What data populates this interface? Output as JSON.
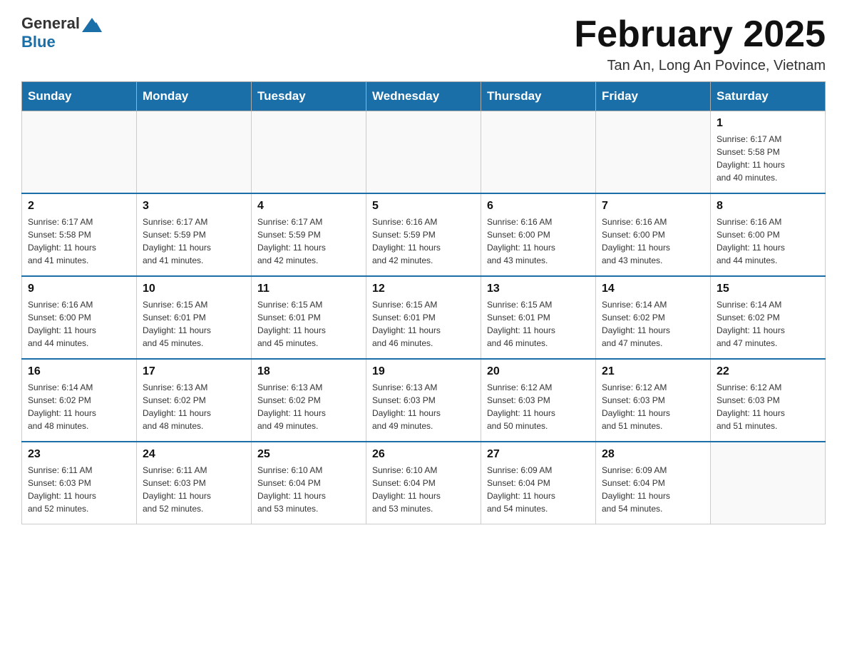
{
  "header": {
    "logo_general": "General",
    "logo_blue": "Blue",
    "month_title": "February 2025",
    "subtitle": "Tan An, Long An Povince, Vietnam"
  },
  "days_of_week": [
    "Sunday",
    "Monday",
    "Tuesday",
    "Wednesday",
    "Thursday",
    "Friday",
    "Saturday"
  ],
  "weeks": [
    [
      {
        "day": "",
        "info": ""
      },
      {
        "day": "",
        "info": ""
      },
      {
        "day": "",
        "info": ""
      },
      {
        "day": "",
        "info": ""
      },
      {
        "day": "",
        "info": ""
      },
      {
        "day": "",
        "info": ""
      },
      {
        "day": "1",
        "info": "Sunrise: 6:17 AM\nSunset: 5:58 PM\nDaylight: 11 hours\nand 40 minutes."
      }
    ],
    [
      {
        "day": "2",
        "info": "Sunrise: 6:17 AM\nSunset: 5:58 PM\nDaylight: 11 hours\nand 41 minutes."
      },
      {
        "day": "3",
        "info": "Sunrise: 6:17 AM\nSunset: 5:59 PM\nDaylight: 11 hours\nand 41 minutes."
      },
      {
        "day": "4",
        "info": "Sunrise: 6:17 AM\nSunset: 5:59 PM\nDaylight: 11 hours\nand 42 minutes."
      },
      {
        "day": "5",
        "info": "Sunrise: 6:16 AM\nSunset: 5:59 PM\nDaylight: 11 hours\nand 42 minutes."
      },
      {
        "day": "6",
        "info": "Sunrise: 6:16 AM\nSunset: 6:00 PM\nDaylight: 11 hours\nand 43 minutes."
      },
      {
        "day": "7",
        "info": "Sunrise: 6:16 AM\nSunset: 6:00 PM\nDaylight: 11 hours\nand 43 minutes."
      },
      {
        "day": "8",
        "info": "Sunrise: 6:16 AM\nSunset: 6:00 PM\nDaylight: 11 hours\nand 44 minutes."
      }
    ],
    [
      {
        "day": "9",
        "info": "Sunrise: 6:16 AM\nSunset: 6:00 PM\nDaylight: 11 hours\nand 44 minutes."
      },
      {
        "day": "10",
        "info": "Sunrise: 6:15 AM\nSunset: 6:01 PM\nDaylight: 11 hours\nand 45 minutes."
      },
      {
        "day": "11",
        "info": "Sunrise: 6:15 AM\nSunset: 6:01 PM\nDaylight: 11 hours\nand 45 minutes."
      },
      {
        "day": "12",
        "info": "Sunrise: 6:15 AM\nSunset: 6:01 PM\nDaylight: 11 hours\nand 46 minutes."
      },
      {
        "day": "13",
        "info": "Sunrise: 6:15 AM\nSunset: 6:01 PM\nDaylight: 11 hours\nand 46 minutes."
      },
      {
        "day": "14",
        "info": "Sunrise: 6:14 AM\nSunset: 6:02 PM\nDaylight: 11 hours\nand 47 minutes."
      },
      {
        "day": "15",
        "info": "Sunrise: 6:14 AM\nSunset: 6:02 PM\nDaylight: 11 hours\nand 47 minutes."
      }
    ],
    [
      {
        "day": "16",
        "info": "Sunrise: 6:14 AM\nSunset: 6:02 PM\nDaylight: 11 hours\nand 48 minutes."
      },
      {
        "day": "17",
        "info": "Sunrise: 6:13 AM\nSunset: 6:02 PM\nDaylight: 11 hours\nand 48 minutes."
      },
      {
        "day": "18",
        "info": "Sunrise: 6:13 AM\nSunset: 6:02 PM\nDaylight: 11 hours\nand 49 minutes."
      },
      {
        "day": "19",
        "info": "Sunrise: 6:13 AM\nSunset: 6:03 PM\nDaylight: 11 hours\nand 49 minutes."
      },
      {
        "day": "20",
        "info": "Sunrise: 6:12 AM\nSunset: 6:03 PM\nDaylight: 11 hours\nand 50 minutes."
      },
      {
        "day": "21",
        "info": "Sunrise: 6:12 AM\nSunset: 6:03 PM\nDaylight: 11 hours\nand 51 minutes."
      },
      {
        "day": "22",
        "info": "Sunrise: 6:12 AM\nSunset: 6:03 PM\nDaylight: 11 hours\nand 51 minutes."
      }
    ],
    [
      {
        "day": "23",
        "info": "Sunrise: 6:11 AM\nSunset: 6:03 PM\nDaylight: 11 hours\nand 52 minutes."
      },
      {
        "day": "24",
        "info": "Sunrise: 6:11 AM\nSunset: 6:03 PM\nDaylight: 11 hours\nand 52 minutes."
      },
      {
        "day": "25",
        "info": "Sunrise: 6:10 AM\nSunset: 6:04 PM\nDaylight: 11 hours\nand 53 minutes."
      },
      {
        "day": "26",
        "info": "Sunrise: 6:10 AM\nSunset: 6:04 PM\nDaylight: 11 hours\nand 53 minutes."
      },
      {
        "day": "27",
        "info": "Sunrise: 6:09 AM\nSunset: 6:04 PM\nDaylight: 11 hours\nand 54 minutes."
      },
      {
        "day": "28",
        "info": "Sunrise: 6:09 AM\nSunset: 6:04 PM\nDaylight: 11 hours\nand 54 minutes."
      },
      {
        "day": "",
        "info": ""
      }
    ]
  ]
}
